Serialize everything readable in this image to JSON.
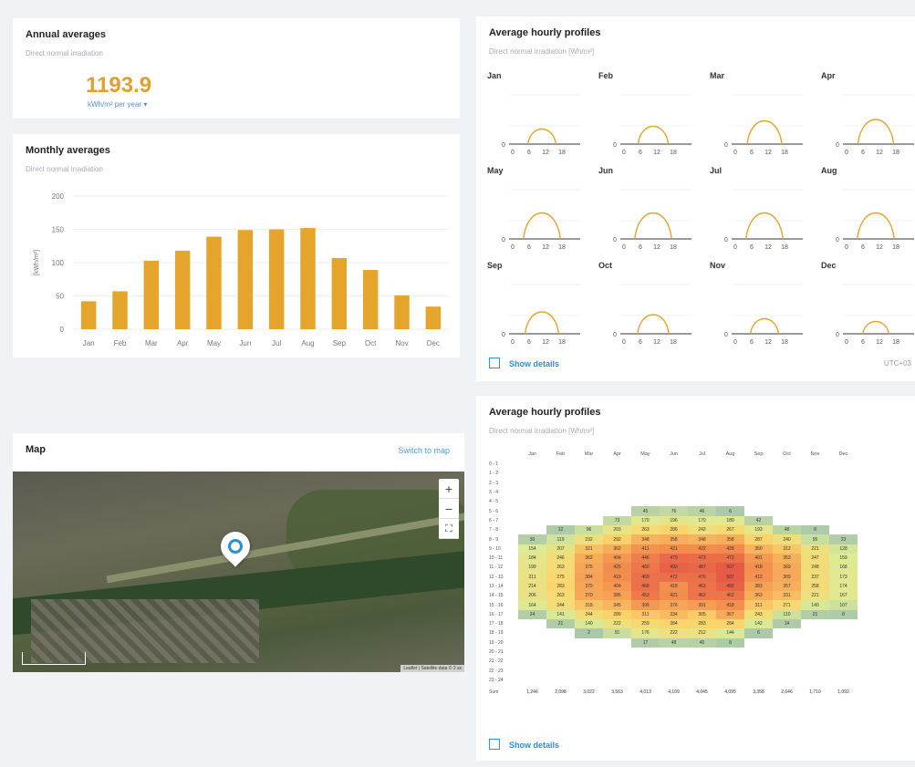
{
  "annual": {
    "title": "Annual averages",
    "subtitle": "Direct normal irradiation",
    "value": "1193.9",
    "unit": "kWh/m² per year ▾"
  },
  "monthly": {
    "title": "Monthly averages",
    "subtitle": "Direct normal irradiation",
    "color": "#e5a42c"
  },
  "chart_data": {
    "type": "bar",
    "categories": [
      "Jan",
      "Feb",
      "Mar",
      "Apr",
      "May",
      "Jun",
      "Jul",
      "Aug",
      "Sep",
      "Oct",
      "Nov",
      "Dec"
    ],
    "values": [
      42,
      57,
      103,
      118,
      139,
      149,
      150,
      152,
      107,
      89,
      51,
      34
    ],
    "ylabel": "[kWh/m²]",
    "ylim": [
      0,
      200
    ],
    "yticks": [
      0,
      50,
      100,
      150,
      200
    ],
    "grid": true
  },
  "map": {
    "title": "Map",
    "switch_label": "Switch to map",
    "zoom_in": "+",
    "zoom_out": "−",
    "fullscreen": "⛶",
    "attribution": "Leaflet | Satellite data © 2 ss"
  },
  "profiles": {
    "title": "Average hourly profiles",
    "subtitle": "Direct normal irradiation [Wh/m²]",
    "months": [
      "Jan",
      "Feb",
      "Mar",
      "Apr",
      "May",
      "Jun",
      "Jul",
      "Aug",
      "Sep",
      "Oct",
      "Nov",
      "Dec"
    ],
    "peaks": [
      0.45,
      0.55,
      0.75,
      0.8,
      0.85,
      0.85,
      0.85,
      0.85,
      0.7,
      0.6,
      0.45,
      0.35
    ],
    "xticks": [
      "0",
      "6",
      "12",
      "18"
    ],
    "zero": "0",
    "show_details": "Show details",
    "utc": "UTC+03"
  },
  "heatmap": {
    "title": "Average hourly profiles",
    "subtitle": "Direct normal irradiation [Wh/m²]",
    "columns": [
      "Jan",
      "Feb",
      "Mar",
      "Apr",
      "May",
      "Jun",
      "Jul",
      "Aug",
      "Sep",
      "Oct",
      "Nov",
      "Dec"
    ],
    "rows": [
      {
        "label": "0 - 1",
        "values": [
          "",
          "",
          "",
          "",
          "",
          "",
          "",
          "",
          "",
          "",
          "",
          ""
        ]
      },
      {
        "label": "1 - 2",
        "values": [
          "",
          "",
          "",
          "",
          "",
          "",
          "",
          "",
          "",
          "",
          "",
          ""
        ]
      },
      {
        "label": "2 - 3",
        "values": [
          "",
          "",
          "",
          "",
          "",
          "",
          "",
          "",
          "",
          "",
          "",
          ""
        ]
      },
      {
        "label": "3 - 4",
        "values": [
          "",
          "",
          "",
          "",
          "",
          "",
          "",
          "",
          "",
          "",
          "",
          ""
        ]
      },
      {
        "label": "4 - 5",
        "values": [
          "",
          "",
          "",
          "",
          "",
          "",
          "",
          "",
          "",
          "",
          "",
          ""
        ]
      },
      {
        "label": "5 - 6",
        "values": [
          "",
          "",
          "",
          "",
          "45",
          "76",
          "46",
          "6",
          "",
          "",
          "",
          ""
        ]
      },
      {
        "label": "6 - 7",
        "values": [
          "",
          "",
          "",
          "73",
          "170",
          "196",
          "170",
          "180",
          "42",
          "",
          "",
          ""
        ]
      },
      {
        "label": "7 - 8",
        "values": [
          "",
          "12",
          "96",
          "203",
          "263",
          "286",
          "242",
          "267",
          "193",
          "48",
          "8",
          ""
        ]
      },
      {
        "label": "8 - 9",
        "values": [
          "30",
          "119",
          "232",
          "292",
          "348",
          "358",
          "348",
          "358",
          "287",
          "240",
          "95",
          "23"
        ]
      },
      {
        "label": "9 - 10",
        "values": [
          "154",
          "207",
          "321",
          "362",
          "411",
          "421",
          "422",
          "428",
          "350",
          "312",
          "221",
          "128"
        ]
      },
      {
        "label": "10 - 11",
        "values": [
          "184",
          "246",
          "362",
          "404",
          "446",
          "479",
          "473",
          "473",
          "401",
          "353",
          "247",
          "159"
        ]
      },
      {
        "label": "11 - 12",
        "values": [
          "199",
          "263",
          "375",
          "425",
          "460",
          "493",
          "487",
          "507",
          "418",
          "369",
          "248",
          "168"
        ]
      },
      {
        "label": "12 - 13",
        "values": [
          "211",
          "275",
          "384",
          "419",
          "469",
          "472",
          "470",
          "507",
          "412",
          "369",
          "237",
          "173"
        ]
      },
      {
        "label": "13 - 14",
        "values": [
          "214",
          "283",
          "379",
          "404",
          "468",
          "418",
          "463",
          "492",
          "383",
          "357",
          "258",
          "174"
        ]
      },
      {
        "label": "14 - 15",
        "values": [
          "206",
          "263",
          "370",
          "385",
          "453",
          "421",
          "462",
          "462",
          "363",
          "331",
          "221",
          "167"
        ]
      },
      {
        "label": "15 - 16",
        "values": [
          "164",
          "244",
          "318",
          "345",
          "399",
          "376",
          "391",
          "418",
          "311",
          "271",
          "140",
          "107"
        ]
      },
      {
        "label": "16 - 17",
        "values": [
          "24",
          "141",
          "244",
          "289",
          "311",
          "334",
          "305",
          "367",
          "243",
          "110",
          "21",
          "8"
        ]
      },
      {
        "label": "17 - 18",
        "values": [
          "",
          "21",
          "140",
          "222",
          "259",
          "284",
          "283",
          "284",
          "142",
          "14",
          "",
          ""
        ]
      },
      {
        "label": "18 - 19",
        "values": [
          "",
          "",
          "2",
          "91",
          "176",
          "222",
          "212",
          "144",
          "6",
          "",
          "",
          ""
        ]
      },
      {
        "label": "19 - 20",
        "values": [
          "",
          "",
          "",
          "",
          "17",
          "48",
          "40",
          "8",
          "",
          "",
          "",
          ""
        ]
      },
      {
        "label": "20 - 21",
        "values": [
          "",
          "",
          "",
          "",
          "",
          "",
          "",
          "",
          "",
          "",
          "",
          ""
        ]
      },
      {
        "label": "21 - 22",
        "values": [
          "",
          "",
          "",
          "",
          "",
          "",
          "",
          "",
          "",
          "",
          "",
          ""
        ]
      },
      {
        "label": "22 - 23",
        "values": [
          "",
          "",
          "",
          "",
          "",
          "",
          "",
          "",
          "",
          "",
          "",
          ""
        ]
      },
      {
        "label": "23 - 24",
        "values": [
          "",
          "",
          "",
          "",
          "",
          "",
          "",
          "",
          "",
          "",
          "",
          ""
        ]
      }
    ],
    "sum_label": "Sum",
    "sums": [
      "1,246",
      "2,098",
      "3,022",
      "3,563",
      "4,013",
      "4,109",
      "4,045",
      "4,095",
      "3,358",
      "2,646",
      "1,710",
      "1,092"
    ],
    "show_details": "Show details"
  }
}
